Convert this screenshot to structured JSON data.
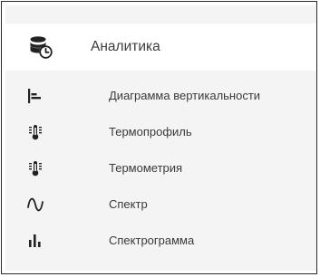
{
  "menu": {
    "header": {
      "label": "Аналитика",
      "icon": "database-clock-icon"
    },
    "items": [
      {
        "label": "Диаграмма вертикальности",
        "icon": "bar-chart-horizontal-icon"
      },
      {
        "label": "Термопрофиль",
        "icon": "thermometer-icon"
      },
      {
        "label": "Термометрия",
        "icon": "thermometer-icon"
      },
      {
        "label": "Спектр",
        "icon": "sine-wave-icon"
      },
      {
        "label": "Спектрограмма",
        "icon": "bar-chart-vertical-icon"
      }
    ]
  },
  "colors": {
    "menu_background": "#f4f4f4",
    "header_background": "#ffffff",
    "text": "#3a3a3a",
    "icon": "#222222"
  }
}
